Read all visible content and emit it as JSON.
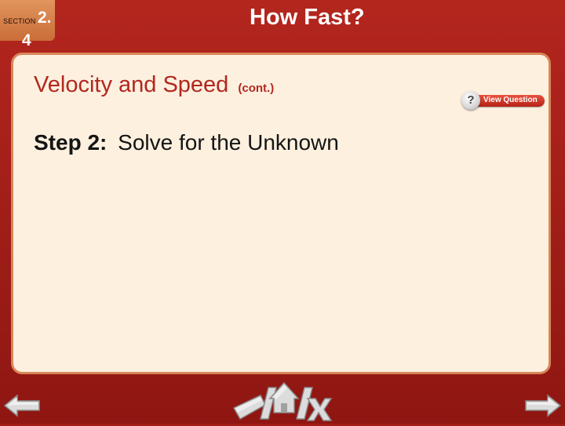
{
  "header": {
    "section_word": "SECTION",
    "section_number_top": "2.",
    "section_number_bottom": "4",
    "title": "How Fast?"
  },
  "content": {
    "title": "Velocity and Speed",
    "title_suffix": "(cont.)",
    "step_label": "Step 2:",
    "step_text": "Solve for the Unknown"
  },
  "view_question": {
    "label": "View Question",
    "icon_glyph": "?"
  },
  "navigation": {
    "back_icon": "arrow-left-icon",
    "next_icon": "arrow-right-icon",
    "center_icons": [
      "resources-icon",
      "home-icon",
      "exit-icon"
    ]
  },
  "colors": {
    "background": "#a31c17",
    "section_badge": "#d88048",
    "panel_background": "#fdf0df",
    "panel_border": "#d7875a",
    "heading": "#b2271f",
    "arrow_fill": "#dcdcdc"
  }
}
